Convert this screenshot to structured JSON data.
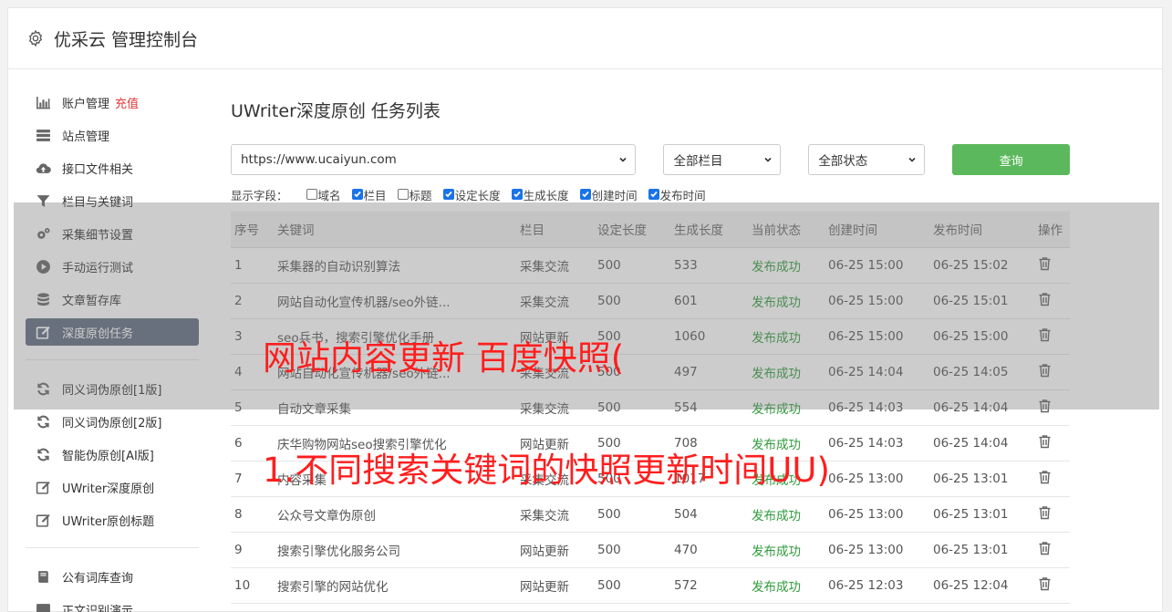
{
  "header": {
    "title": "优采云 管理控制台",
    "icon": "gear-icon"
  },
  "sidebar": {
    "items": [
      {
        "label": "账户管理",
        "extra": "充值",
        "icon": "bar-chart-icon"
      },
      {
        "label": "站点管理",
        "icon": "server-icon"
      },
      {
        "label": "接口文件相关",
        "icon": "cloud-upload-icon"
      },
      {
        "label": "栏目与关键词",
        "icon": "filter-icon"
      },
      {
        "label": "采集细节设置",
        "icon": "cogs-icon"
      },
      {
        "label": "手动运行测试",
        "icon": "play-circle-icon"
      },
      {
        "label": "文章暂存库",
        "icon": "database-icon"
      },
      {
        "label": "深度原创任务",
        "icon": "edit-icon",
        "active": true
      }
    ],
    "group2": [
      {
        "label": "同义词伪原创[1版]",
        "icon": "refresh-icon"
      },
      {
        "label": "同义词伪原创[2版]",
        "icon": "refresh-icon"
      },
      {
        "label": "智能伪原创[AI版]",
        "icon": "refresh-icon"
      },
      {
        "label": "UWriter深度原创",
        "icon": "edit-icon"
      },
      {
        "label": "UWriter原创标题",
        "icon": "edit-icon"
      }
    ],
    "group3": [
      {
        "label": "公有词库查询",
        "icon": "book-icon"
      },
      {
        "label": "正文识别演示",
        "icon": "monitor-icon"
      }
    ]
  },
  "main": {
    "title": "UWriter深度原创 任务列表",
    "site_select": "https://www.ucaiyun.com",
    "column_select": "全部栏目",
    "status_select": "全部状态",
    "query_label": "查询",
    "fields_label": "显示字段：",
    "fields": [
      {
        "label": "域名",
        "checked": false
      },
      {
        "label": "栏目",
        "checked": true
      },
      {
        "label": "标题",
        "checked": false
      },
      {
        "label": "设定长度",
        "checked": true
      },
      {
        "label": "生成长度",
        "checked": true
      },
      {
        "label": "创建时间",
        "checked": true
      },
      {
        "label": "发布时间",
        "checked": true
      }
    ],
    "columns": [
      "序号",
      "关键词",
      "栏目",
      "设定长度",
      "生成长度",
      "当前状态",
      "创建时间",
      "发布时间",
      "操作"
    ],
    "rows": [
      [
        "1",
        "采集器的自动识别算法",
        "采集交流",
        "500",
        "533",
        "发布成功",
        "06-25 15:00",
        "06-25 15:02"
      ],
      [
        "2",
        "网站自动化宣传机器/seo外链...",
        "采集交流",
        "500",
        "601",
        "发布成功",
        "06-25 15:00",
        "06-25 15:01"
      ],
      [
        "3",
        "seo兵书，搜索引擎优化手册",
        "网站更新",
        "500",
        "1060",
        "发布成功",
        "06-25 15:00",
        "06-25 15:00"
      ],
      [
        "4",
        "网站自动化宣传机器/seo外链...",
        "采集交流",
        "500",
        "497",
        "发布成功",
        "06-25 14:04",
        "06-25 14:05"
      ],
      [
        "5",
        "自动文章采集",
        "采集交流",
        "500",
        "554",
        "发布成功",
        "06-25 14:03",
        "06-25 14:04"
      ],
      [
        "6",
        "庆华购物网站seo搜索引擎优化",
        "网站更新",
        "500",
        "708",
        "发布成功",
        "06-25 14:03",
        "06-25 14:04"
      ],
      [
        "7",
        "内容采集",
        "采集交流",
        "500",
        "1017",
        "发布成功",
        "06-25 13:00",
        "06-25 13:01"
      ],
      [
        "8",
        "公众号文章伪原创",
        "采集交流",
        "500",
        "504",
        "发布成功",
        "06-25 13:00",
        "06-25 13:01"
      ],
      [
        "9",
        "搜索引擎优化服务公司",
        "网站更新",
        "500",
        "470",
        "发布成功",
        "06-25 13:00",
        "06-25 13:01"
      ],
      [
        "10",
        "搜索引擎的网站优化",
        "网站更新",
        "500",
        "572",
        "发布成功",
        "06-25 12:03",
        "06-25 12:04"
      ]
    ],
    "row_action_icon": "trash-icon"
  },
  "overlay": {
    "line1": "网站内容更新 百度快照(",
    "line2": "1.不同搜索关键词的快照更新时间UU)"
  },
  "colors": {
    "accent": "#5cb85c",
    "active_nav": "#5f6b80",
    "status_ok": "#2e9b3a",
    "overlay_text": "#ff1e1e",
    "recharge": "#e4393c"
  }
}
